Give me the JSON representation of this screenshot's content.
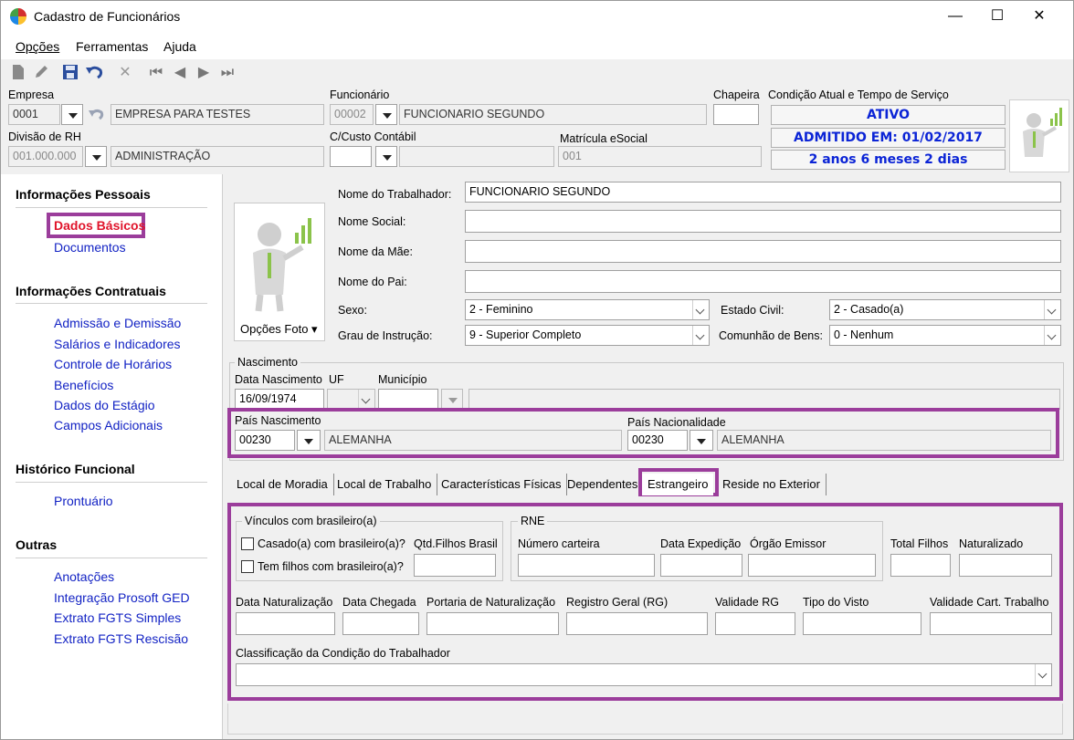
{
  "window": {
    "title": "Cadastro de Funcionários",
    "minimize": "—",
    "maximize": "☐",
    "close": "✕"
  },
  "menu": [
    "Opções",
    "Ferramentas",
    "Ajuda"
  ],
  "toolbar_icons": [
    "new-icon",
    "edit-icon",
    "save-icon",
    "undo-icon",
    "delete-icon",
    "first-icon",
    "prev-icon",
    "next-icon",
    "last-icon"
  ],
  "header": {
    "empresa_label": "Empresa",
    "empresa_code": "0001",
    "empresa_name": "EMPRESA PARA TESTES",
    "funcionario_label": "Funcionário",
    "funcionario_code": "00002",
    "funcionario_name": "FUNCIONARIO SEGUNDO",
    "chapeira_label": "Chapeira",
    "chapeira_value": "",
    "condicao_label": "Condição Atual e Tempo de Serviço",
    "status": "ATIVO",
    "admitido": "ADMITIDO EM: 01/02/2017",
    "tempo": "2 anos 6 meses 2 dias",
    "divisao_label": "Divisão de RH",
    "divisao_code": "001.000.000",
    "divisao_name": "ADMINISTRAÇÃO",
    "ccusto_label": "C/Custo Contábil",
    "ccusto_value": "",
    "matricula_label": "Matrícula eSocial",
    "matricula_value": "001"
  },
  "sidebar": {
    "sections": [
      {
        "title": "Informações Pessoais",
        "items": [
          "Dados Básicos",
          "Documentos"
        ]
      },
      {
        "title": "Informações Contratuais",
        "items": [
          "Admissão e Demissão",
          "Salários e Indicadores",
          "Controle de Horários",
          "Benefícios",
          "Dados do Estágio",
          "Campos Adicionais"
        ]
      },
      {
        "title": "Histórico Funcional",
        "items": [
          "Prontuário"
        ]
      },
      {
        "title": "Outras",
        "items": [
          "Anotações",
          "Integração Prosoft GED",
          "Extrato FGTS Simples",
          "Extrato FGTS Rescisão"
        ]
      }
    ],
    "active_item": "Dados Básicos",
    "active_color": "#e0142b",
    "link_color": "#1323c4"
  },
  "basic": {
    "photo_button": "Opções Foto ▾",
    "nome_label": "Nome do Trabalhador:",
    "nome_value": "FUNCIONARIO SEGUNDO",
    "social_label": "Nome Social:",
    "social_value": "",
    "mae_label": "Nome da Mãe:",
    "mae_value": "",
    "pai_label": "Nome do Pai:",
    "pai_value": "",
    "sexo_label": "Sexo:",
    "sexo_value": "2 - Feminino",
    "estado_label": "Estado Civil:",
    "estado_value": "2 - Casado(a)",
    "grau_label": "Grau de Instrução:",
    "grau_value": "9 - Superior Completo",
    "comunhao_label": "Comunhão de Bens:",
    "comunhao_value": "0 - Nenhum"
  },
  "nascimento": {
    "group_title": "Nascimento",
    "data_label": "Data Nascimento",
    "data_value": "16/09/1974",
    "uf_label": "UF",
    "municipio_label": "Município",
    "pais_nasc_label": "País Nascimento",
    "pais_nasc_code": "00230",
    "pais_nasc_name": "ALEMANHA",
    "pais_nac_label": "País Nacionalidade",
    "pais_nac_code": "00230",
    "pais_nac_name": "ALEMANHA"
  },
  "tabs": [
    "Local de Moradia",
    "Local de Trabalho",
    "Características Físicas",
    "Dependentes",
    "Estrangeiro",
    "Reside no Exterior"
  ],
  "active_tab": "Estrangeiro",
  "estrangeiro": {
    "vinculos_title": "Vínculos com brasileiro(a)",
    "casado_label": "Casado(a) com brasileiro(a)?",
    "filhos_label": "Tem filhos com brasileiro(a)?",
    "qtd_filhos_label": "Qtd.Filhos Brasil",
    "rne_title": "RNE",
    "numero_label": "Número carteira",
    "expedicao_label": "Data Expedição",
    "orgao_label": "Órgão Emissor",
    "total_filhos_label": "Total Filhos",
    "naturalizado_label": "Naturalizado",
    "data_nat_label": "Data Naturalização",
    "data_chegada_label": "Data Chegada",
    "portaria_label": "Portaria de Naturalização",
    "rg_label": "Registro Geral (RG)",
    "validade_rg_label": "Validade RG",
    "visto_label": "Tipo do Visto",
    "validade_cart_label": "Validade Cart. Trabalho",
    "classificacao_label": "Classificação da Condição do Trabalhador",
    "classificacao_value": ""
  },
  "colors": {
    "highlight": "#9b3d9b",
    "status_blue": "#0b24d6"
  }
}
